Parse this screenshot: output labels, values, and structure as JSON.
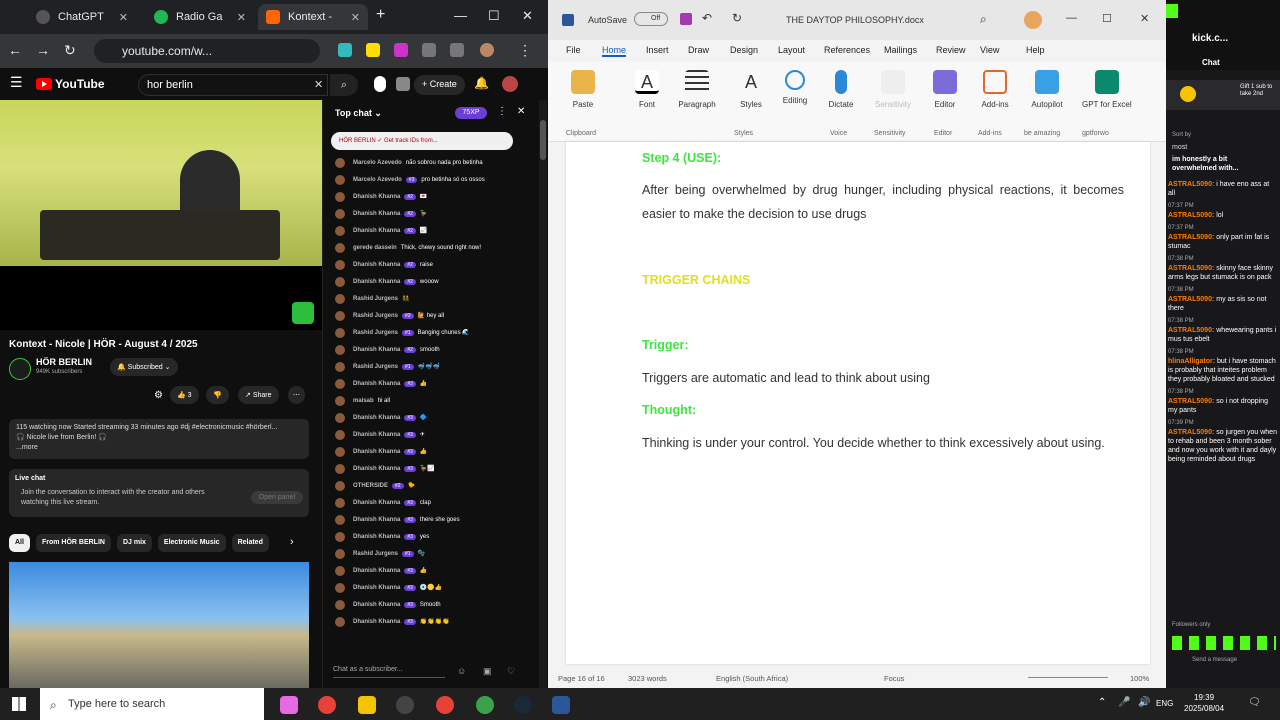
{
  "browser": {
    "tabs": [
      {
        "label": "ChatGPT"
      },
      {
        "label": "Radio Ga"
      },
      {
        "label": "Kontext -"
      }
    ],
    "url": "youtube.com/w..."
  },
  "youtube": {
    "logo": "YouTube",
    "search_value": "hor berlin",
    "create_label": "+ Create",
    "video_title": "Kontext - Nicole | HÖR - August 4 / 2025",
    "channel_name": "HÖR BERLIN",
    "subscribers": "949K subscribers",
    "subscribed_label": "Subscribed",
    "likes": "3",
    "share_label": "Share",
    "desc_line1": "115 watching now  Started streaming 33 minutes ago  #dj #electronicmusic #hörberl...",
    "desc_line2": "🎧 Nicole live from Berlin! 🎧",
    "desc_more": "...more",
    "livechat_title": "Live chat",
    "livechat_text": "Join the conversation to interact with the creator and others watching this live stream.",
    "open_panel": "Open panel",
    "chips": [
      "All",
      "From HÖR BERLIN",
      "DJ mix",
      "Electronic Music",
      "Related"
    ]
  },
  "chat": {
    "header": "Top chat",
    "xp_badge": "75XP",
    "pinned": "HÖR BERLIN ✓  Get track IDs from...",
    "messages": [
      {
        "author": "Marcelo Azevedo",
        "badge": "",
        "text": "não sobrou nada pro betinha"
      },
      {
        "author": "Marcelo Azevedo",
        "badge": "#3",
        "text": "pro betinha só os ossos"
      },
      {
        "author": "Dhanish Khanna",
        "badge": "#2",
        "text": "💌"
      },
      {
        "author": "Dhanish Khanna",
        "badge": "#2",
        "text": "🦆"
      },
      {
        "author": "Dhanish Khanna",
        "badge": "#2",
        "text": "📈"
      },
      {
        "author": "gerede dassein",
        "badge": "",
        "text": "Thick, chewy sound right now!"
      },
      {
        "author": "Dhanish Khanna",
        "badge": "#2",
        "text": "raise"
      },
      {
        "author": "Dhanish Khanna",
        "badge": "#2",
        "text": "wooow"
      },
      {
        "author": "Rashid Jurgens",
        "badge": "",
        "text": "👯"
      },
      {
        "author": "Rashid Jurgens",
        "badge": "#3",
        "text": "🙋 hey all"
      },
      {
        "author": "Rashid Jurgens",
        "badge": "#1",
        "text": "Banging chunes 🌊"
      },
      {
        "author": "Dhanish Khanna",
        "badge": "#2",
        "text": "smooth"
      },
      {
        "author": "Rashid Jurgens",
        "badge": "#1",
        "text": "🤿🤿🤿"
      },
      {
        "author": "Dhanish Khanna",
        "badge": "#3",
        "text": "👍"
      },
      {
        "author": "maisab",
        "badge": "",
        "text": "hi all"
      },
      {
        "author": "Dhanish Khanna",
        "badge": "#3",
        "text": "🔷"
      },
      {
        "author": "Dhanish Khanna",
        "badge": "#3",
        "text": "✈"
      },
      {
        "author": "Dhanish Khanna",
        "badge": "#3",
        "text": "👍"
      },
      {
        "author": "Dhanish Khanna",
        "badge": "#3",
        "text": "🦆📈"
      },
      {
        "author": "OTHERSIDE",
        "badge": "#2",
        "text": "🐤"
      },
      {
        "author": "Dhanish Khanna",
        "badge": "#3",
        "text": "clap"
      },
      {
        "author": "Dhanish Khanna",
        "badge": "#3",
        "text": "there she goes"
      },
      {
        "author": "Dhanish Khanna",
        "badge": "#3",
        "text": "yes"
      },
      {
        "author": "Rashid Jurgens",
        "badge": "#1",
        "text": "🫧"
      },
      {
        "author": "Dhanish Khanna",
        "badge": "#3",
        "text": "👍"
      },
      {
        "author": "Dhanish Khanna",
        "badge": "#3",
        "text": "💿🟡👍"
      },
      {
        "author": "Dhanish Khanna",
        "badge": "#3",
        "text": "Smooth"
      },
      {
        "author": "Dhanish Khanna",
        "badge": "#3",
        "text": "👏👏👏👏"
      }
    ],
    "input_placeholder": "Chat as a subscriber..."
  },
  "word": {
    "autosave": "AutoSave",
    "autosave_state": "Off",
    "doc_title": "THE DAYTOP PHILOSOPHY.docx",
    "menu": [
      "File",
      "Home",
      "Insert",
      "Draw",
      "Design",
      "Layout",
      "References",
      "Mailings",
      "Review",
      "View",
      "Help"
    ],
    "ribbon": [
      "Paste",
      "Font",
      "Paragraph",
      "Styles",
      "Editing",
      "Dictate",
      "Sensitivity",
      "Editor",
      "Add-ins",
      "Autopilot",
      "GPT for Excel W"
    ],
    "groups": [
      "Clipboard",
      "Styles",
      "Voice",
      "Sensitivity",
      "Editor",
      "Add-ins",
      "be amazing",
      "gptforwo"
    ],
    "step4": "Step 4 (USE):",
    "para1": "After being overwhelmed by drug hunger, including physical reactions, it becomes easier to make the decision to use drugs",
    "trigger_chains": "TRIGGER CHAINS",
    "trigger": "Trigger:",
    "para2": "Triggers are automatic and lead to think about using",
    "thought": "Thought:",
    "para3": "Thinking is under your control. You decide whether to think excessively about using.",
    "status_page": "Page 16 of 16",
    "status_words": "3023 words",
    "status_lang": "English (South Africa)",
    "status_focus": "Focus",
    "zoom": "100%"
  },
  "kick": {
    "url": "kick.c...",
    "header": "Chat",
    "gift": "Gift 1 sub to take 2nd",
    "sort_label": "Sort by",
    "pinned": "most",
    "pinned_text": "im honestly a bit overwhelmed with...",
    "messages": [
      {
        "time": "",
        "name": "ASTRAL5090:",
        "text": "i have eno ass at all"
      },
      {
        "time": "07:37 PM",
        "name": "ASTRAL5090:",
        "text": "lol"
      },
      {
        "time": "07:37 PM",
        "name": "ASTRAL5090:",
        "text": "only part im fat is stumac"
      },
      {
        "time": "07:38 PM",
        "name": "ASTRAL5090:",
        "text": "skinny face skinny arms legs but stumack is on pack"
      },
      {
        "time": "07:38 PM",
        "name": "ASTRAL5090:",
        "text": "my as sis so not there"
      },
      {
        "time": "07:38 PM",
        "name": "ASTRAL5090:",
        "text": "whewearing pants i mus tus ebelt"
      },
      {
        "time": "07:38 PM",
        "name": "hlinaAlligator:",
        "text": "but i have stomach is probably that inteites problem they probably bloated and stucked"
      },
      {
        "time": "07:38 PM",
        "name": "ASTRAL5090:",
        "text": "so i not dropping my pants"
      },
      {
        "time": "07:39 PM",
        "name": "ASTRAL5090:",
        "text": "so jurgen you when to rehab and been 3 month sober and now you work with it and dayly being reminded about drugs"
      }
    ],
    "followers_only": "Followers only",
    "send_placeholder": "Send a message"
  },
  "taskbar": {
    "search_placeholder": "Type here to search",
    "lang": "ENG",
    "time": "19:39",
    "date": "2025/08/04"
  }
}
